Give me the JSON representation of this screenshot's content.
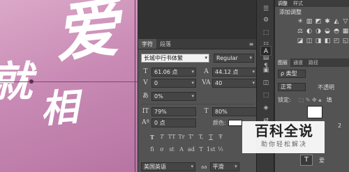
{
  "canvas": {
    "char_ai": "爱",
    "char_xiang": "相",
    "char_jiu": "就"
  },
  "character_panel": {
    "tab_character": "字符",
    "tab_paragraph": "段落",
    "menu": "≡",
    "font_family": "长城中行书体繁",
    "font_style": "Regular",
    "font_size": "61.06 点",
    "leading": "44.12 点",
    "kerning": "0",
    "tracking": "40",
    "tsume": "0%",
    "vertical_scale": "79%",
    "horizontal_scale": "80%",
    "baseline_shift": "0 点",
    "color_label": "颜色:",
    "language": "美国英语",
    "anti_alias_icon": "aa",
    "anti_alias": "平滑",
    "style_buttons": [
      "T",
      "T",
      "TT",
      "Tr",
      "T'",
      "T,",
      "T",
      "Ŧ"
    ],
    "opentype_buttons": [
      "fi",
      "σ",
      "st",
      "A",
      "ad",
      "T",
      "1st",
      "½"
    ]
  },
  "tools": {
    "icons": [
      "☰",
      "⚙",
      "⬚",
      "☷",
      "▤",
      "▣",
      "◫",
      "A",
      "¶",
      "⬚",
      "◈",
      "⇄",
      "◐"
    ],
    "active_index": 7
  },
  "right_panel": {
    "tab_adjust": "调整",
    "tab_style": "样式",
    "title": "添加调整",
    "adj_icons": [
      "☀",
      "▥",
      "◩",
      "✱",
      "◭",
      "▽",
      "⚖",
      "◐",
      "◑",
      "◒",
      "◓",
      "▦",
      "◪",
      "◫",
      "◨",
      "◧",
      "◰",
      "◱"
    ],
    "layers_tabs": [
      "图层",
      "通道",
      "路径"
    ],
    "kind_filter": "ρ 类型",
    "blend_mode": "正常",
    "opacity_label": "不透明",
    "lock_label": "锁定:",
    "fill_label": "填",
    "layer_text_name": "爱",
    "layer_name_suffix": "2"
  },
  "watermark": {
    "title": "百科全说",
    "subtitle": "助你轻松解决"
  }
}
